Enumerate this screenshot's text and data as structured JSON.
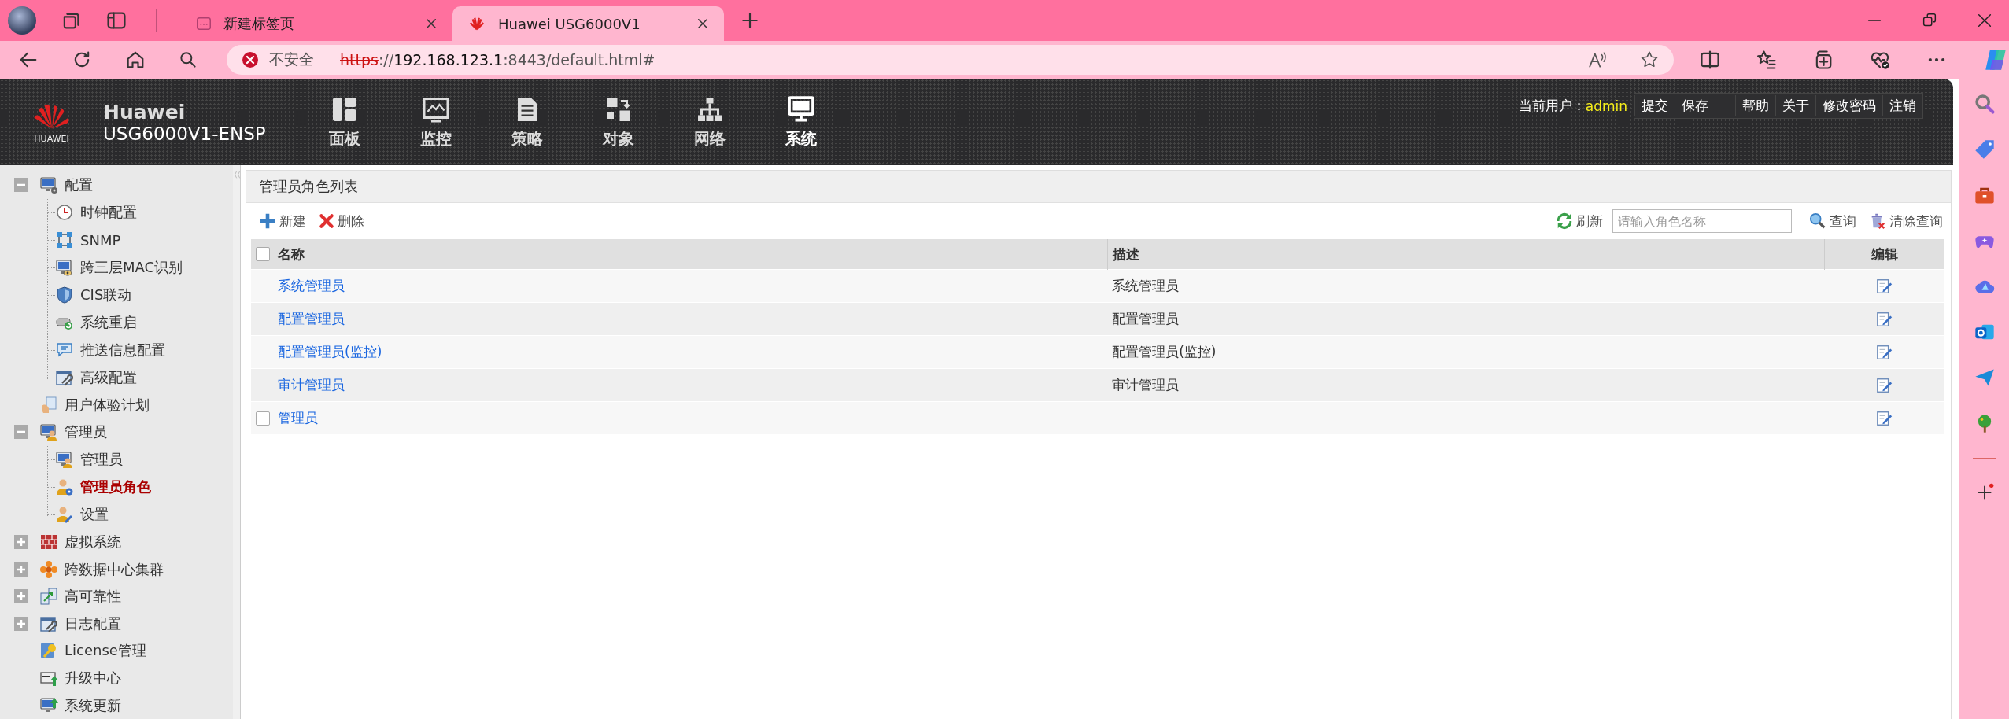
{
  "browser": {
    "tabs": [
      {
        "title": "新建标签页",
        "selected": false
      },
      {
        "title": "Huawei USG6000V1",
        "selected": true
      }
    ],
    "address": {
      "security": "不安全",
      "scheme": "https",
      "separator": "://",
      "host": "192.168.123.1",
      "rest": ":8443/default.html#"
    }
  },
  "header": {
    "brand": "Huawei",
    "model": "USG6000V1-ENSP",
    "logo_text": "HUAWEI",
    "nav": [
      {
        "label": "面板",
        "selected": false
      },
      {
        "label": "监控",
        "selected": false
      },
      {
        "label": "策略",
        "selected": false
      },
      {
        "label": "对象",
        "selected": false
      },
      {
        "label": "网络",
        "selected": false
      },
      {
        "label": "系统",
        "selected": true
      }
    ],
    "user_label": "当前用户：",
    "user": "admin",
    "link_groups": [
      [
        "提交",
        "保存"
      ],
      [
        "帮助",
        "关于",
        "修改密码",
        "注销"
      ]
    ]
  },
  "sidebar": {
    "tree": [
      {
        "label": "配置",
        "expanded": true,
        "selected": false,
        "children": [
          {
            "label": "时钟配置",
            "selected": false
          },
          {
            "label": "SNMP",
            "selected": false
          },
          {
            "label": "跨三层MAC识别",
            "selected": false
          },
          {
            "label": "CIS联动",
            "selected": false
          },
          {
            "label": "系统重启",
            "selected": false
          },
          {
            "label": "推送信息配置",
            "selected": false
          },
          {
            "label": "高级配置",
            "selected": false
          }
        ]
      },
      {
        "label": "用户体验计划",
        "selected": false
      },
      {
        "label": "管理员",
        "expanded": true,
        "selected": false,
        "children": [
          {
            "label": "管理员",
            "selected": false
          },
          {
            "label": "管理员角色",
            "selected": true
          },
          {
            "label": "设置",
            "selected": false
          }
        ]
      },
      {
        "label": "虚拟系统",
        "expanded": false,
        "selected": false
      },
      {
        "label": "跨数据中心集群",
        "expanded": false,
        "selected": false
      },
      {
        "label": "高可靠性",
        "expanded": false,
        "selected": false
      },
      {
        "label": "日志配置",
        "expanded": false,
        "selected": false
      },
      {
        "label": "License管理",
        "selected": false
      },
      {
        "label": "升级中心",
        "selected": false
      },
      {
        "label": "系统更新",
        "selected": false
      }
    ]
  },
  "panel": {
    "title": "管理员角色列表",
    "new": "新建",
    "delete": "删除",
    "refresh": "刷新",
    "search": {
      "placeholder": "请输入角色名称"
    },
    "query": "查询",
    "clear": "清除查询",
    "table": {
      "columns": [
        "名称",
        "描述",
        "编辑"
      ],
      "header_checked": false,
      "rows": [
        {
          "name": "系统管理员",
          "description": "系统管理员",
          "checkable": false
        },
        {
          "name": "配置管理员",
          "description": "配置管理员",
          "checkable": false
        },
        {
          "name": "配置管理员(监控)",
          "description": "配置管理员(监控)",
          "checkable": false
        },
        {
          "name": "审计管理员",
          "description": "审计管理员",
          "checkable": false
        },
        {
          "name": "管理员",
          "checkable": true,
          "checked": false
        }
      ]
    }
  }
}
